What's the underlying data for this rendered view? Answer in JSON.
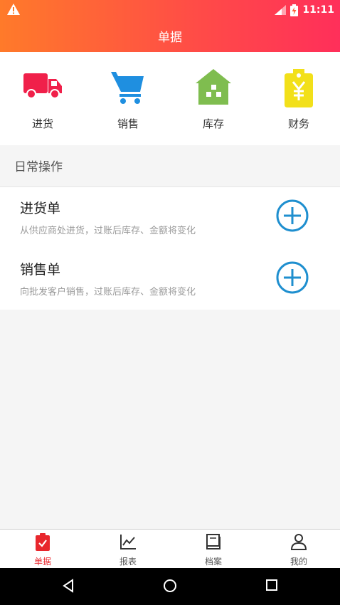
{
  "status_bar": {
    "time": "11:11"
  },
  "header": {
    "title": "单据"
  },
  "quick_actions": [
    {
      "label": "进货",
      "icon": "truck-icon",
      "color": "#f0204a"
    },
    {
      "label": "销售",
      "icon": "cart-icon",
      "color": "#1f8fe0"
    },
    {
      "label": "库存",
      "icon": "warehouse-icon",
      "color": "#7fbd4f"
    },
    {
      "label": "财务",
      "icon": "price-tag-icon",
      "color": "#f2e01a"
    }
  ],
  "section": {
    "title": "日常操作"
  },
  "list": [
    {
      "title": "进货单",
      "desc": "从供应商处进货，过账后库存、金额将变化"
    },
    {
      "title": "销售单",
      "desc": "向批发客户销售，过账后库存、金额将变化"
    }
  ],
  "bottom_nav": [
    {
      "label": "单据",
      "icon": "clipboard-check-icon",
      "active": true
    },
    {
      "label": "报表",
      "icon": "line-chart-icon",
      "active": false
    },
    {
      "label": "档案",
      "icon": "book-icon",
      "active": false
    },
    {
      "label": "我的",
      "icon": "user-icon",
      "active": false
    }
  ],
  "colors": {
    "accent": "#e8272d",
    "add_button": "#1f8fcf",
    "header_start": "#ff7a2a",
    "header_end": "#ff2f5a"
  }
}
